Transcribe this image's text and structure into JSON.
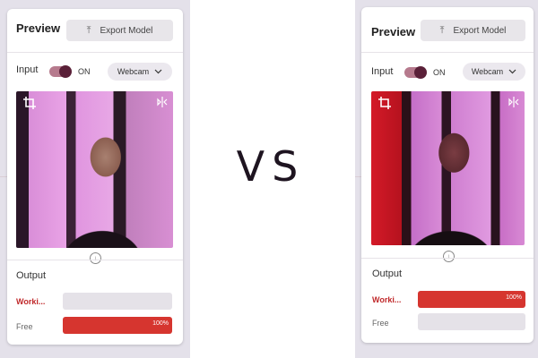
{
  "vs_text": "VS",
  "colors": {
    "accent_red": "#d6352f",
    "label_red": "#c0292b",
    "toggle_track": "#b67a8d",
    "toggle_knob": "#5a2038"
  },
  "panels": [
    {
      "title": "Preview",
      "export_label": "Export Model",
      "export_icon": "upload-icon",
      "input_label": "Input",
      "toggle_state": "ON",
      "source_label": "Webcam",
      "source_icon": "chevron-down-icon",
      "output_label": "Output",
      "classes": [
        {
          "label": "Worki...",
          "percent": 0,
          "percent_text": ""
        },
        {
          "label": "Free",
          "percent": 100,
          "percent_text": "100%"
        }
      ]
    },
    {
      "title": "Preview",
      "export_label": "Export Model",
      "export_icon": "upload-icon",
      "input_label": "Input",
      "toggle_state": "ON",
      "source_label": "Webcam",
      "source_icon": "chevron-down-icon",
      "output_label": "Output",
      "classes": [
        {
          "label": "Worki...",
          "percent": 100,
          "percent_text": "100%"
        },
        {
          "label": "Free",
          "percent": 0,
          "percent_text": ""
        }
      ]
    }
  ]
}
